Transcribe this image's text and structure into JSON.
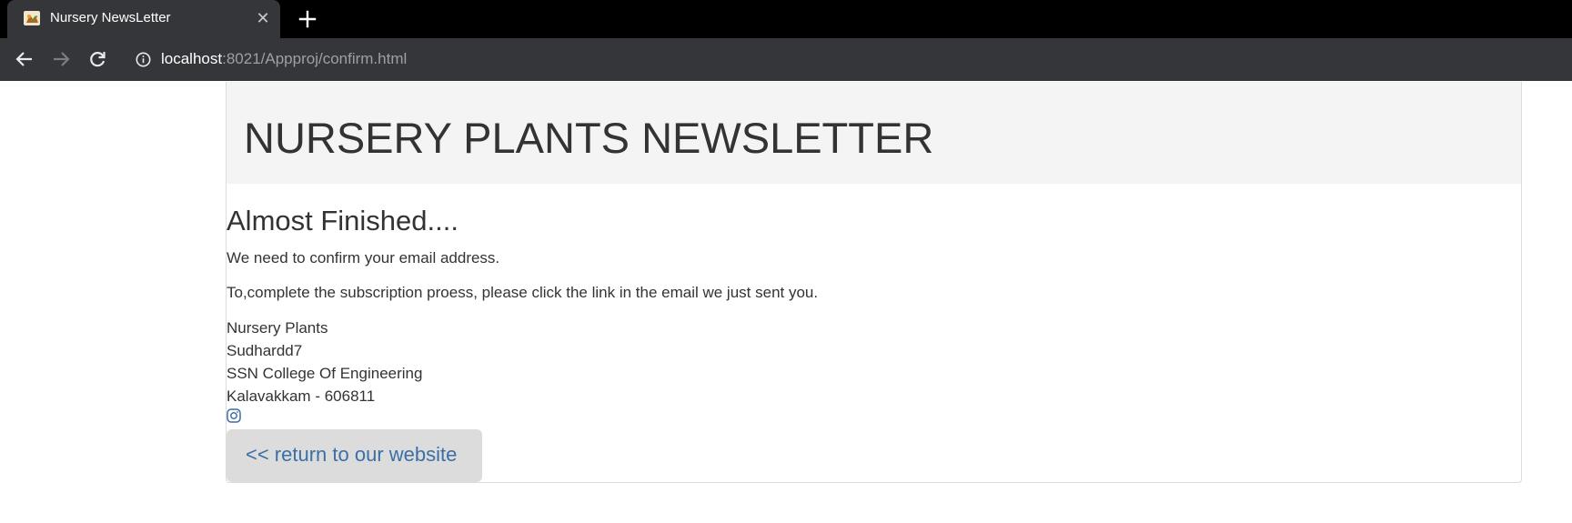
{
  "browser": {
    "tab_title": "Nursery NewsLetter",
    "tab_close": "✕",
    "url_host": "localhost",
    "url_path": ":8021/Appproj/confirm.html"
  },
  "page": {
    "site_title": "NURSERY PLANTS NEWSLETTER",
    "heading": "Almost Finished....",
    "paragraph1": "We need to confirm your email address.",
    "paragraph2": "To,complete the subscription proess, please click the link in the email we just sent you.",
    "address": [
      "Nursery Plants",
      "Sudhardd7",
      "SSN College Of Engineering",
      "Kalavakkam - 606811"
    ],
    "return_label": "<< return to our website"
  },
  "colors": {
    "tabstrip_bg": "#000000",
    "toolbar_bg": "#35363a",
    "jumbotron_bg": "#f4f4f4",
    "text": "#333333",
    "link": "#3b6fa6",
    "button_bg": "#dcdcdc"
  },
  "icons": {
    "favicon": "plant-favicon-icon",
    "close": "close-icon",
    "new_tab": "plus-icon",
    "back": "arrow-left-icon",
    "forward": "arrow-right-icon",
    "reload": "reload-icon",
    "site_info": "info-icon",
    "social": "instagram-icon"
  }
}
